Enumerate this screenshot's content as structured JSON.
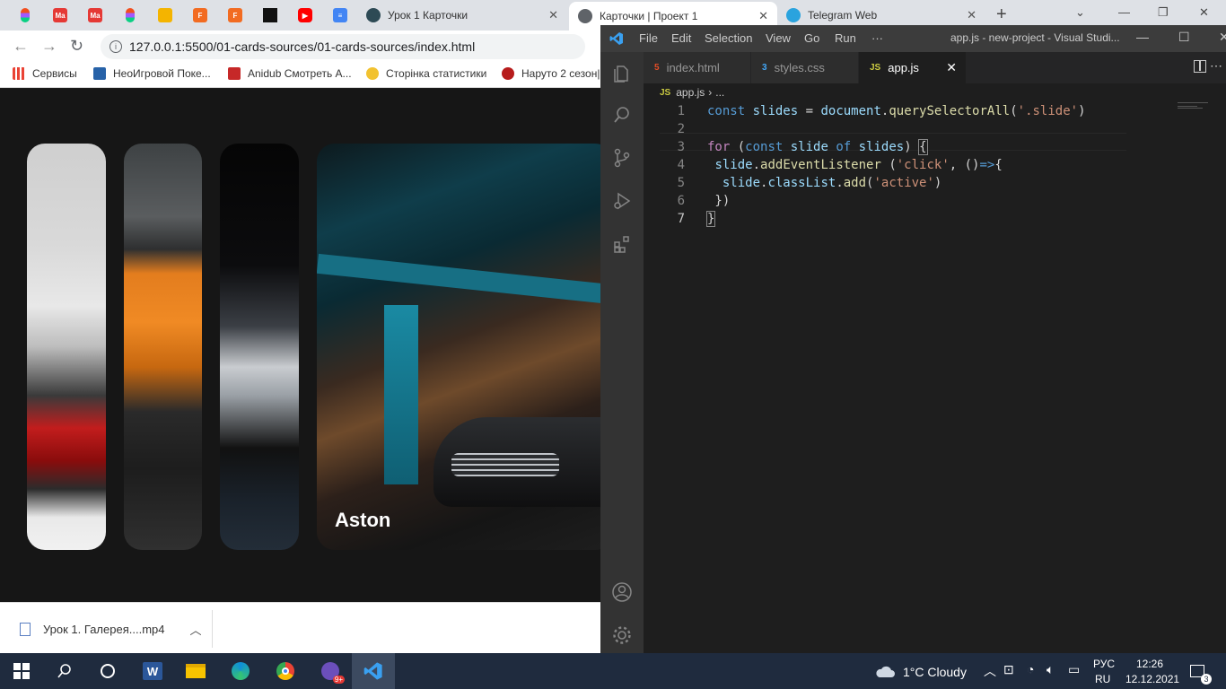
{
  "chrome": {
    "tabs": [
      {
        "title": "Урок 1 Карточки"
      },
      {
        "title": "Карточки | Проект 1"
      },
      {
        "title": "Telegram Web"
      }
    ],
    "address": "127.0.0.1:5500/01-cards-sources/01-cards-sources/index.html",
    "bookmarks": [
      {
        "label": "Сервисы"
      },
      {
        "label": "НеоИгровой Поке..."
      },
      {
        "label": "Anidub Смотреть А..."
      },
      {
        "label": "Сторінка статистики"
      },
      {
        "label": "Наруто 2 сезон|"
      }
    ]
  },
  "page": {
    "slides": [
      {
        "title": ""
      },
      {
        "title": ""
      },
      {
        "title": ""
      },
      {
        "title": "Aston"
      }
    ]
  },
  "downloads": {
    "file": "Урок 1. Галерея....mp4"
  },
  "vscode": {
    "menu": [
      "File",
      "Edit",
      "Selection",
      "View",
      "Go",
      "Run",
      "···"
    ],
    "title": "app.js - new-project - Visual Studi...",
    "tabs": [
      {
        "icon": "5",
        "label": "index.html"
      },
      {
        "icon": "3",
        "label": "styles.css"
      },
      {
        "icon": "JS",
        "label": "app.js"
      }
    ],
    "breadcrumb": {
      "icon": "JS",
      "file": "app.js",
      "rest": "..."
    },
    "lines": [
      "1",
      "2",
      "3",
      "4",
      "5",
      "6",
      "7"
    ],
    "code": [
      {
        "t": "const slides = document.querySelectorAll('.slide')"
      },
      {
        "t": ""
      },
      {
        "t": "for (const slide of slides) {"
      },
      {
        "t": " slide.addEventListener ('click', ()=>{"
      },
      {
        "t": "  slide.classList.add('active')"
      },
      {
        "t": " })"
      },
      {
        "t": "}"
      }
    ]
  },
  "taskbar": {
    "weather": "1°C  Cloudy",
    "lang_top": "РУС",
    "lang_bottom": "RU",
    "time": "12:26",
    "date": "12.12.2021",
    "notifications": "3"
  }
}
